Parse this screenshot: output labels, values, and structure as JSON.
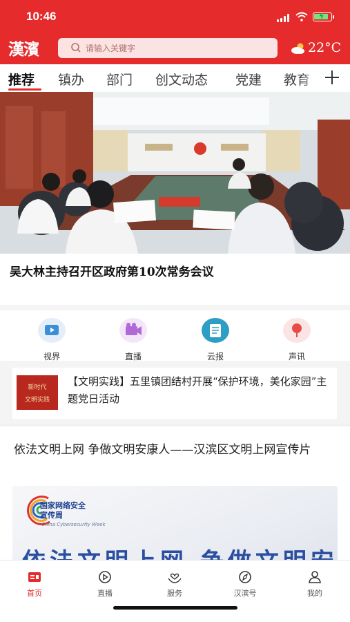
{
  "status_bar": {
    "time": "10:46"
  },
  "header": {
    "logo": "漢濱",
    "search_placeholder": "请输入关键字",
    "weather": {
      "icon": "partly-cloudy-icon",
      "temperature": "22°C"
    }
  },
  "tabs": {
    "items": [
      {
        "label": "推荐",
        "active": true
      },
      {
        "label": "镇办"
      },
      {
        "label": "部门"
      },
      {
        "label": "创文动态"
      },
      {
        "label": "党建"
      },
      {
        "label": "教育"
      }
    ],
    "more_icon": "plus-icon"
  },
  "banner": {
    "headline": "吴大林主持召开区政府第10次常务会议",
    "carousel": {
      "count": 6,
      "active_index": 1
    }
  },
  "quick_links": [
    {
      "label": "视界",
      "icon": "tv-icon",
      "color": "#3b8fd9"
    },
    {
      "label": "直播",
      "icon": "video-camera-icon",
      "color": "#b06ad6"
    },
    {
      "label": "云报",
      "icon": "newspaper-icon",
      "color": "#2e9ec4"
    },
    {
      "label": "声讯",
      "icon": "microphone-icon",
      "color": "#e84a4a"
    }
  ],
  "notice": {
    "thumb_line1": "新时代",
    "thumb_line2": "文明实践",
    "text": "【文明实践】五里镇团结村开展“保护环境，美化家园”主题党日活动"
  },
  "article": {
    "title": "依法文明上网 争做文明安康人——汉滨区文明上网宣传片",
    "image": {
      "badge_title": "国家网络安全宣传周",
      "badge_en": "China Cybersecurity Week",
      "slogan": "依法文明上网 争做文明安康人"
    }
  },
  "bottom_nav": [
    {
      "label": "首页",
      "icon": "home-icon",
      "active": true
    },
    {
      "label": "直播",
      "icon": "play-icon"
    },
    {
      "label": "服务",
      "icon": "heart-hands-icon"
    },
    {
      "label": "汉滨号",
      "icon": "compass-icon"
    },
    {
      "label": "我的",
      "icon": "user-icon"
    }
  ],
  "colors": {
    "brand_red": "#e52b2b"
  }
}
